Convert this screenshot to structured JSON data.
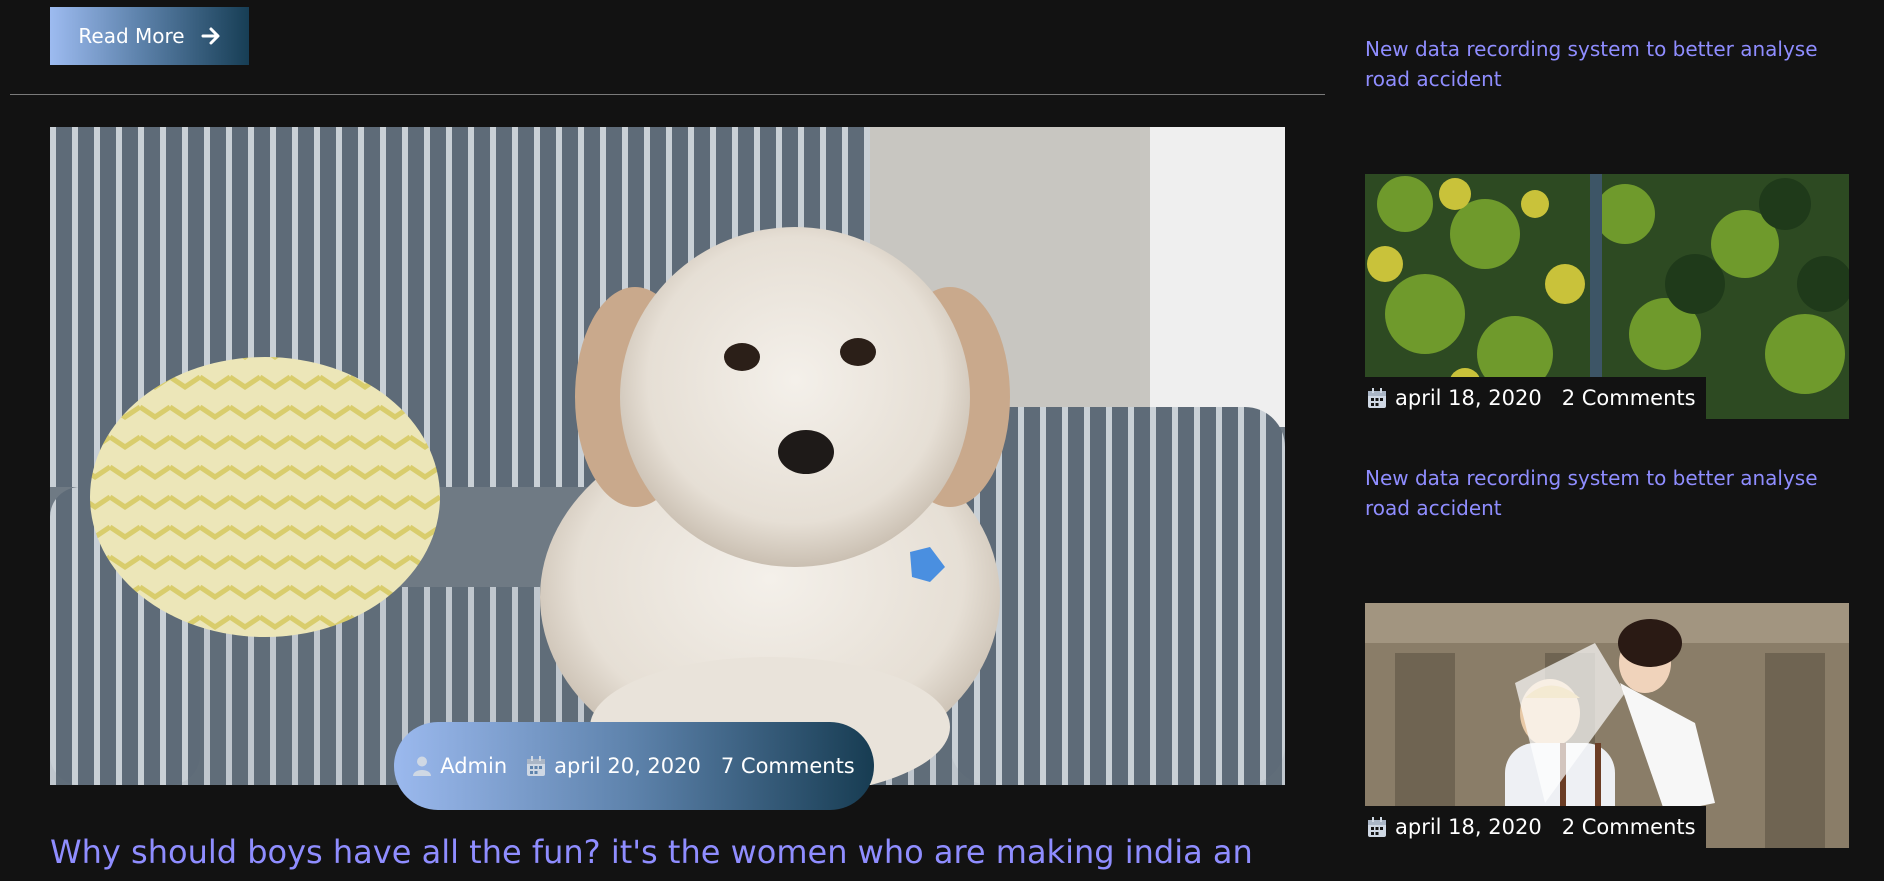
{
  "main": {
    "read_more_label": "Read More",
    "post": {
      "author": "Admin",
      "date": "april 20, 2020",
      "comments": "7 Comments",
      "title": "Why should boys have all the fun? it's the women who are making india an"
    }
  },
  "sidebar": {
    "posts": [
      {
        "title": "New data recording system to better analyse road accident",
        "date": "april 18, 2020",
        "comments": "2 Comments"
      },
      {
        "title": "New data recording system to better analyse road accident",
        "date": "april 18, 2020",
        "comments": "2 Comments"
      }
    ]
  },
  "colors": {
    "background": "#121212",
    "link": "#8f8dff",
    "gradient_start": "#9dbbf0",
    "gradient_end": "#173e55"
  },
  "icons": {
    "read_more": "arrow-right-icon",
    "author": "user-icon",
    "date": "calendar-icon"
  }
}
